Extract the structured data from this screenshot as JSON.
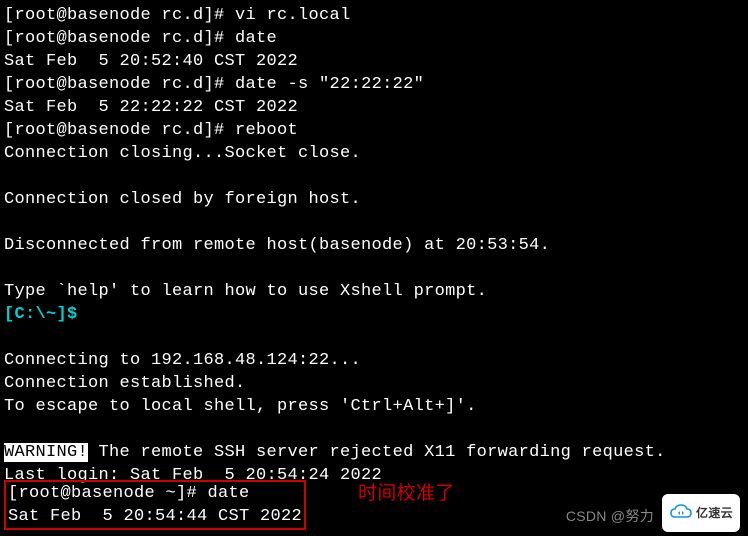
{
  "prompt1": "[root@basenode rc.d]# ",
  "prompt2": "[root@basenode ~]# ",
  "cmds": {
    "vi": "vi rc.local",
    "date1": "date",
    "dateset": "date -s \"22:22:22\"",
    "reboot": "reboot",
    "date2": "date"
  },
  "outputs": {
    "date1": "Sat Feb  5 20:52:40 CST 2022",
    "dateset": "Sat Feb  5 22:22:22 CST 2022",
    "closing": "Connection closing...Socket close.",
    "closed": "Connection closed by foreign host.",
    "disconnected": "Disconnected from remote host(basenode) at 20:53:54.",
    "help": "Type `help' to learn how to use Xshell prompt.",
    "localprompt": "[C:\\~]$ ",
    "connecting": "Connecting to 192.168.48.124:22...",
    "established": "Connection established.",
    "escape": "To escape to local shell, press 'Ctrl+Alt+]'.",
    "warning_label": "WARNING!",
    "warning_rest": " The remote SSH server rejected X11 forwarding request.",
    "lastlogin": "Last login: Sat Feb  5 20:54:24 2022",
    "date2": "Sat Feb  5 20:54:44 CST 2022"
  },
  "annotation": "时间校准了",
  "watermark": "CSDN @努力",
  "logo_text": "亿速云"
}
